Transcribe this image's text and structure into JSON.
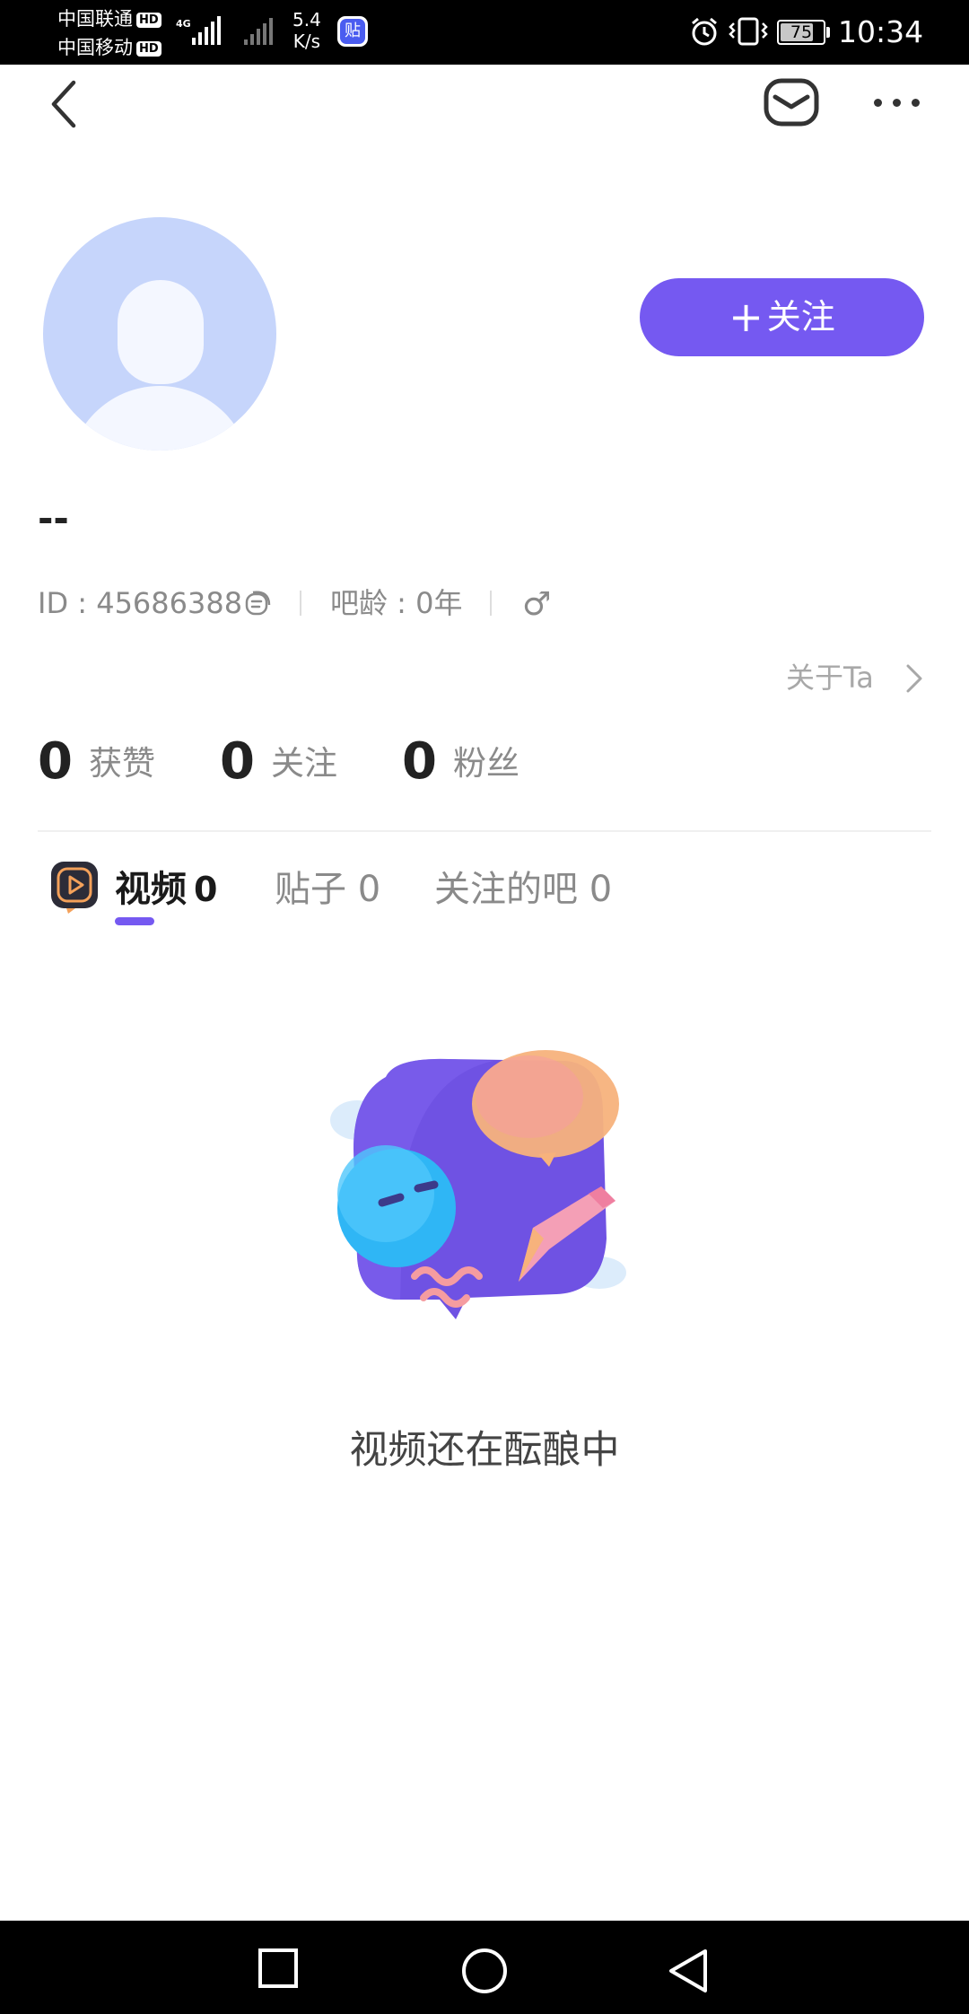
{
  "status_bar": {
    "carrier_1": "中国联通",
    "carrier_2": "中国移动",
    "hd": "HD",
    "network": "4G",
    "speed_value": "5.4",
    "speed_unit": "K/s",
    "app_badge": "贴",
    "battery": "75",
    "time": "10:34"
  },
  "header": {
    "back": "back-arrow-icon",
    "mail": "mail-icon",
    "more": "more-icon"
  },
  "profile": {
    "follow_label": "关注",
    "follow_plus": "+",
    "username": "--",
    "id_text": "ID : 45686388",
    "bar_age_text": "吧龄 : 0年",
    "gender_symbol": "♂",
    "about_label": "关于Ta",
    "accent_color": "#7559f1"
  },
  "stats": [
    {
      "count": "0",
      "label": "获赞"
    },
    {
      "count": "0",
      "label": "关注"
    },
    {
      "count": "0",
      "label": "粉丝"
    }
  ],
  "tabs": {
    "video_label": "视频",
    "video_count": "0",
    "posts_label": "贴子 0",
    "bars_label": "关注的吧 0",
    "active": "视频"
  },
  "empty_state": {
    "text": "视频还在酝酿中"
  },
  "nav_bar": {
    "items": [
      "recent-apps-icon",
      "home-icon",
      "back-icon"
    ]
  }
}
